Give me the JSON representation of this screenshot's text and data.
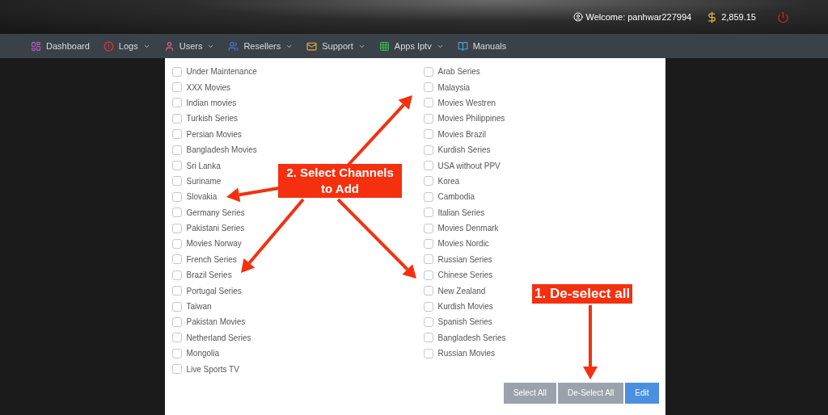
{
  "header": {
    "welcome": "Welcome: panhwar227994",
    "balance": "2,859.15"
  },
  "nav": [
    {
      "label": "Dashboard",
      "dropdown": false
    },
    {
      "label": "Logs",
      "dropdown": true
    },
    {
      "label": "Users",
      "dropdown": true
    },
    {
      "label": "Resellers",
      "dropdown": true
    },
    {
      "label": "Support",
      "dropdown": true
    },
    {
      "label": "Apps Iptv",
      "dropdown": true
    },
    {
      "label": "Manuals",
      "dropdown": false
    }
  ],
  "channels_left": [
    {
      "label": "Under Maintenance",
      "checked": false
    },
    {
      "label": "XXX Movies",
      "checked": false
    },
    {
      "label": "Indian movies",
      "checked": false
    },
    {
      "label": "Turkish Series",
      "checked": false
    },
    {
      "label": "Persian Movies",
      "checked": false
    },
    {
      "label": "Bangladesh Movies",
      "checked": false
    },
    {
      "label": "Sri Lanka",
      "checked": false
    },
    {
      "label": "Suriname",
      "checked": false
    },
    {
      "label": "Slovakia",
      "checked": false
    },
    {
      "label": "Germany Series",
      "checked": false
    },
    {
      "label": "Pakistani Series",
      "checked": false
    },
    {
      "label": "Movies Norway",
      "checked": false
    },
    {
      "label": "French Series",
      "checked": false
    },
    {
      "label": "Brazil Series",
      "checked": false
    },
    {
      "label": "Portugal Series",
      "checked": false
    },
    {
      "label": "Taiwan",
      "checked": false
    },
    {
      "label": "Pakistan Movies",
      "checked": false
    },
    {
      "label": "Netherland Series",
      "checked": false
    },
    {
      "label": "Mongolia",
      "checked": false
    },
    {
      "label": "Live Sports TV",
      "checked": false
    }
  ],
  "channels_right": [
    {
      "label": "Arab Series",
      "checked": false
    },
    {
      "label": "Malaysia",
      "checked": false
    },
    {
      "label": "Movies Westren",
      "checked": false
    },
    {
      "label": "Movies Philippines",
      "checked": false
    },
    {
      "label": "Movies Brazil",
      "checked": false
    },
    {
      "label": "Kurdish Series",
      "checked": false
    },
    {
      "label": "USA without PPV",
      "checked": false
    },
    {
      "label": "Korea",
      "checked": false
    },
    {
      "label": "Cambodia",
      "checked": false
    },
    {
      "label": "Italian Series",
      "checked": false
    },
    {
      "label": "Movies Denmark",
      "checked": false
    },
    {
      "label": "Movies Nordic",
      "checked": false
    },
    {
      "label": "Russian Series",
      "checked": false
    },
    {
      "label": "Chinese Series",
      "checked": false
    },
    {
      "label": "New Zealand",
      "checked": false
    },
    {
      "label": "Kurdish Movies",
      "checked": false
    },
    {
      "label": "Spanish Series",
      "checked": false
    },
    {
      "label": "Bangladesh Series",
      "checked": false
    },
    {
      "label": "Russian Movies",
      "checked": false
    }
  ],
  "buttons": [
    {
      "label": "Select All",
      "kind": "secondary"
    },
    {
      "label": "De-Select All",
      "kind": "secondary"
    },
    {
      "label": "Edit",
      "kind": "primary"
    }
  ],
  "annotations": [
    {
      "lines": [
        "2. Select Channels",
        "to Add"
      ]
    },
    {
      "lines": [
        "1. De-select all"
      ]
    }
  ]
}
